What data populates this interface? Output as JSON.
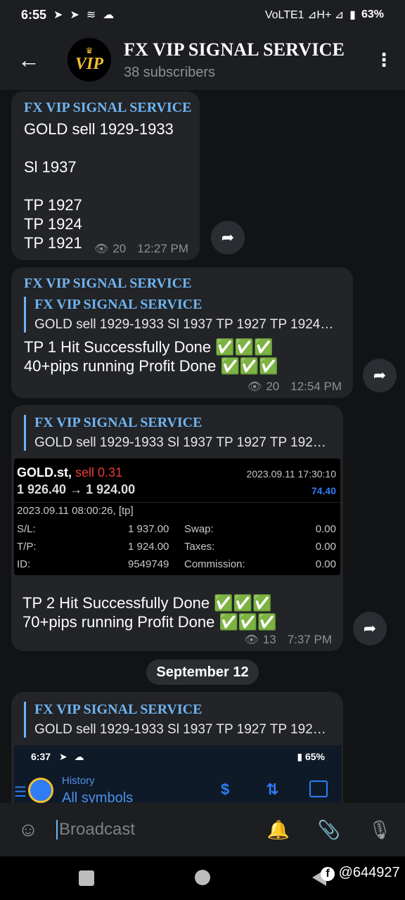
{
  "status": {
    "time": "6:55",
    "net": "VoLTE1 ⊿H+ ⊿",
    "battery": "63%"
  },
  "header": {
    "title": "FX VIP SIGNAL SERVICE",
    "subscribers": "38 subscribers",
    "avatar_text": "VIP"
  },
  "msg1": {
    "sender": "FX VIP SIGNAL SERVICE",
    "lines": [
      "GOLD sell 1929-1933",
      "",
      "Sl 1937",
      "",
      "TP 1927",
      "TP 1924",
      "TP 1921"
    ],
    "views": "20",
    "time": "12:27 PM"
  },
  "msg2": {
    "sender": "FX VIP SIGNAL SERVICE",
    "reply_name": "FX VIP SIGNAL SERVICE",
    "reply_text": "GOLD sell 1929-1933  Sl 1937  TP 1927 TP 1924…",
    "line1": "TP 1 Hit Successfully Done ✅✅✅",
    "line2": "40+pips running Profit Done ✅✅✅",
    "views": "20",
    "time": "12:54 PM"
  },
  "msg3": {
    "reply_name": "FX VIP SIGNAL SERVICE",
    "reply_text": "GOLD sell 1929-1933  Sl 1937  TP 1927 TP 192…",
    "trade": {
      "symbol": "GOLD.st,",
      "side": "sell 0.31",
      "datetime": "2023.09.11 17:30:10",
      "prices": "1 926.40 → 1 924.00",
      "profit": "74.40",
      "opened": "2023.09.11 08:00:26, [tp]",
      "sl_label": "S/L:",
      "sl_value": "1 937.00",
      "tp_label": "T/P:",
      "tp_value": "1 924.00",
      "id_label": "ID:",
      "id_value": "9549749",
      "swap_label": "Swap:",
      "swap_value": "0.00",
      "taxes_label": "Taxes:",
      "taxes_value": "0.00",
      "comm_label": "Commission:",
      "comm_value": "0.00"
    },
    "line1": "TP 2 Hit Successfully Done ✅✅✅",
    "line2": "70+pips running Profit Done ✅✅✅",
    "views": "13",
    "time": "7:37 PM"
  },
  "date_chip": "September 12",
  "msg4": {
    "reply_name": "FX VIP SIGNAL SERVICE",
    "reply_text": "GOLD sell 1929-1933  Sl 1937  TP 1927 TP 192…",
    "shot_time": "6:37",
    "shot_battery": "65%",
    "shot_history": "History",
    "shot_symbols": "All symbols"
  },
  "composer": {
    "placeholder": "Broadcast"
  },
  "watermark": "@644927",
  "colors": {
    "accent": "#6fb4f2",
    "bubble": "#222427",
    "bar": "#1c1e21",
    "sell": "#e53935",
    "profit": "#2f7cf6"
  }
}
